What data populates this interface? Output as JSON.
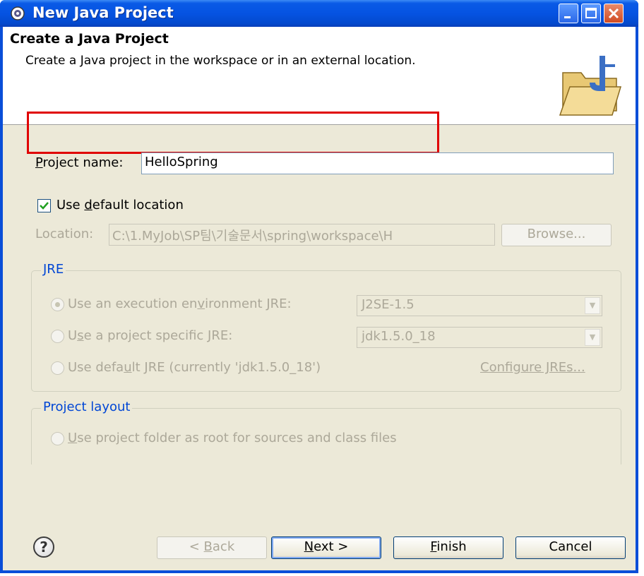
{
  "window": {
    "title": "New Java Project"
  },
  "banner": {
    "title": "Create a Java Project",
    "description": "Create a Java project in the workspace or in an external location."
  },
  "project_name": {
    "label_mnemonic": "P",
    "label_rest": "roject name:",
    "value": "HelloSpring"
  },
  "default_location": {
    "checked": true,
    "label_pre": "Use ",
    "label_mnemonic": "d",
    "label_post": "efault location"
  },
  "location": {
    "label": "Location:",
    "value": "C:\\1.MyJob\\SP팀\\기술문서\\spring\\workspace\\H",
    "browse_label": "Browse..."
  },
  "jre_group": {
    "title": "JRE",
    "option1_pre": "Use an execution en",
    "option1_mnemonic": "v",
    "option1_post": "ironment JRE:",
    "option1_value": "J2SE-1.5",
    "option2_pre": "U",
    "option2_mnemonic": "s",
    "option2_post": "e a project specific JRE:",
    "option2_value": "jdk1.5.0_18",
    "option3_pre": "Use defa",
    "option3_mnemonic": "u",
    "option3_post": "lt JRE (currently 'jdk1.5.0_18')",
    "configure_link": "Configure JREs..."
  },
  "layout_group": {
    "title": "Project layout",
    "option1_mnemonic": "U",
    "option1_post": "se project folder as root for sources and class files"
  },
  "buttons": {
    "help": "?",
    "back_pre": "< ",
    "back_mnemonic": "B",
    "back_post": "ack",
    "next_mnemonic": "N",
    "next_post": "ext >",
    "finish_mnemonic": "F",
    "finish_post": "inish",
    "cancel": "Cancel"
  }
}
